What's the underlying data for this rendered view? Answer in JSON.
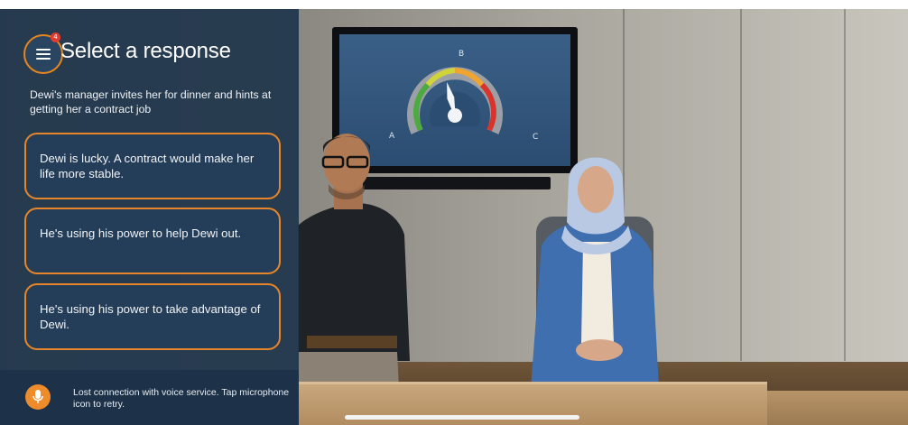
{
  "panel": {
    "menu_badge": "4",
    "title": "Select a response",
    "prompt": "Dewi's manager invites her for dinner and hints at getting her a contract job",
    "responses": [
      {
        "label": "Dewi is lucky. A contract would make her life more stable."
      },
      {
        "label": "He's using his power to help Dewi out."
      },
      {
        "label": "He's using his power to take advantage of Dewi."
      }
    ]
  },
  "status": {
    "message": "Lost connection with voice service. Tap microphone icon to retry.",
    "icon": "microphone-icon"
  },
  "gauge": {
    "labels": {
      "left": "A",
      "top": "B",
      "right": "C"
    },
    "needle_level": 0.45
  },
  "colors": {
    "accent": "#e8861e",
    "panel": "#22374e",
    "badge": "#e33a2e"
  }
}
